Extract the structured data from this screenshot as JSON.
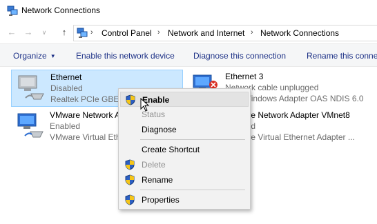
{
  "window": {
    "title": "Network Connections",
    "icon": "network-connections-icon"
  },
  "nav": {
    "back_icon": "back-arrow-icon",
    "forward_icon": "forward-arrow-icon",
    "recent_icon": "chevron-down-icon",
    "up_icon": "up-arrow-icon",
    "breadcrumb": [
      "Control Panel",
      "Network and Internet",
      "Network Connections"
    ]
  },
  "commandbar": {
    "organize": "Organize",
    "enable": "Enable this network device",
    "diagnose": "Diagnose this connection",
    "rename": "Rename this conne"
  },
  "connections": [
    {
      "name": "Ethernet",
      "status": "Disabled",
      "device": "Realtek PCIe GBE F",
      "selected": true
    },
    {
      "name": "Ethernet 3",
      "status": "Network cable unplugged",
      "device": "TAP-Windows Adapter OAS NDIS 6.0",
      "selected": false
    },
    {
      "name": "VMware Network A",
      "status": "Enabled",
      "device": "VMware Virtual Eth",
      "selected": false
    },
    {
      "name": "VMware Network Adapter VMnet8",
      "status": "Enabled",
      "device": "VMware Virtual Ethernet Adapter ...",
      "selected": false
    }
  ],
  "context_menu": {
    "items": [
      {
        "label": "Enable",
        "shield": true,
        "bold": true,
        "disabled": false,
        "hover": true
      },
      {
        "label": "Status",
        "shield": false,
        "bold": false,
        "disabled": true
      },
      {
        "label": "Diagnose",
        "shield": false,
        "bold": false,
        "disabled": false
      },
      {
        "label": "Create Shortcut",
        "shield": false,
        "bold": false,
        "disabled": false
      },
      {
        "label": "Delete",
        "shield": true,
        "bold": false,
        "disabled": true
      },
      {
        "label": "Rename",
        "shield": true,
        "bold": false,
        "disabled": false
      },
      {
        "label": "Properties",
        "shield": true,
        "bold": false,
        "disabled": false
      }
    ]
  },
  "colors": {
    "accent_text": "#1e3287",
    "selection": "#cce8ff",
    "selection_border": "#99d1ff",
    "menu_bg": "#f2f2f2"
  }
}
